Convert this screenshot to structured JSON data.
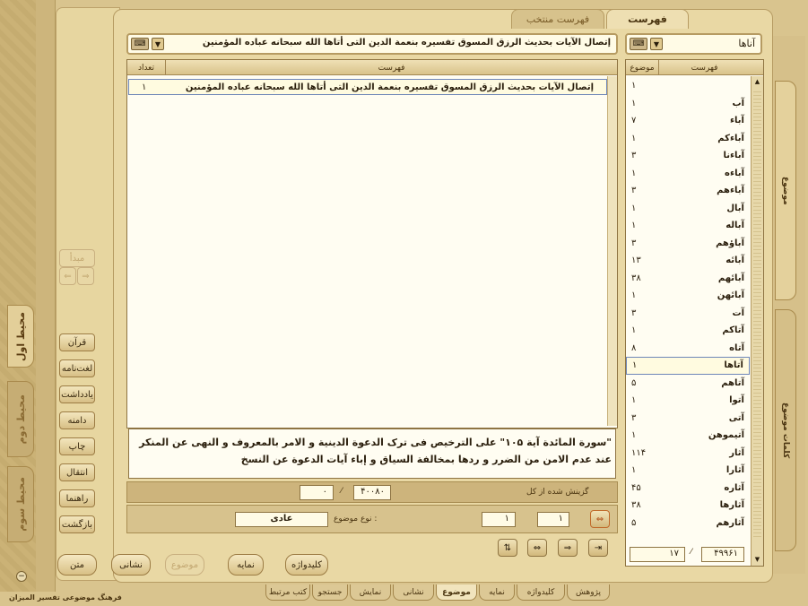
{
  "app_title": "فرهنگ موضوعی تفسیر المیزان",
  "top_tabs": {
    "active": "فهرست",
    "inactive": "فهرست منتخب"
  },
  "left_tabs": [
    "محیط اول",
    "محیط دوم",
    "محیط سوم"
  ],
  "side": {
    "start": "مبدأ",
    "buttons": [
      "قرآن",
      "لغت‌نامه",
      "یادداشت",
      "دامنه",
      "چاپ",
      "انتقال",
      "راهنما",
      "بازگشت"
    ]
  },
  "search_right": {
    "value": "آناها"
  },
  "search_left": {
    "value": "إتصال الآیات بحدیث الرزق المسوق تفسیره بنعمة الدین التی أتاها الله سبحانه عباده المؤمنین"
  },
  "right_list": {
    "col_index": "فهرست",
    "col_count": "موضوع",
    "rows": [
      {
        "w": "",
        "n": "۱"
      },
      {
        "w": "آب",
        "n": "۱"
      },
      {
        "w": "آباء",
        "n": "۷"
      },
      {
        "w": "آباءکم",
        "n": "۱"
      },
      {
        "w": "آباءنا",
        "n": "۳"
      },
      {
        "w": "آباءه",
        "n": "۱"
      },
      {
        "w": "آباءهم",
        "n": "۳"
      },
      {
        "w": "آبال",
        "n": "۱"
      },
      {
        "w": "آباله",
        "n": "۱"
      },
      {
        "w": "آباؤهم",
        "n": "۳"
      },
      {
        "w": "آبائه",
        "n": "۱۳"
      },
      {
        "w": "آبائهم",
        "n": "۳۸"
      },
      {
        "w": "آبائهن",
        "n": "۱"
      },
      {
        "w": "آت",
        "n": "۳"
      },
      {
        "w": "آتاکم",
        "n": "۱"
      },
      {
        "w": "آتاه",
        "n": "۸"
      },
      {
        "w": "آتاها",
        "n": "۱"
      },
      {
        "w": "آتاهم",
        "n": "۵"
      },
      {
        "w": "آتوا",
        "n": "۱"
      },
      {
        "w": "آتی",
        "n": "۳"
      },
      {
        "w": "آتیموهن",
        "n": "۱"
      },
      {
        "w": "آثار",
        "n": "۱۱۴"
      },
      {
        "w": "آثارا",
        "n": "۱"
      },
      {
        "w": "آثاره",
        "n": "۴۵"
      },
      {
        "w": "آثارها",
        "n": "۳۸"
      },
      {
        "w": "آثارهم",
        "n": "۵"
      }
    ],
    "selected_index": 16
  },
  "center_list": {
    "col_index": "فهرست",
    "col_count": "تعداد",
    "row_text": "إتصال الآیات بحدیث الرزق المسوق تفسیره بنعمة الدین التی أتاها الله سبحانه عباده المؤمنین",
    "row_count": "۱"
  },
  "text_box": "\"سورة المائدة آیة ۱۰۵\" علی الترخیص فی ترک الدعوة الدینیة و الامر بالمعروف و النهی عن المنکر عند عدم الامن من الضرر و ردها بمخالفة السیاق و إباء آیات الدعوة عن النسخ",
  "mid_bar": {
    "label": "گزینش شده از کل",
    "total": "۴۰۰۸۰",
    "selected": "۰"
  },
  "page_bar": {
    "type_label": "نوع موضوع :",
    "type_value": "عادی",
    "page_a": "۱",
    "page_b": "۱"
  },
  "right_footer": {
    "total": "۴۹۹۶۱",
    "current": "۱۷"
  },
  "right_side_tabs": [
    "موضوع",
    "کلمات موضوع"
  ],
  "bottom_buttons": [
    "متن",
    "نشانی",
    "موضوع",
    "نمایه",
    "کلیدواژه"
  ],
  "bottom_tabs": [
    "کتب مرتبط",
    "جستجو",
    "نمایش",
    "نشانی",
    "موضوع",
    "نمایه",
    "کلیدواژه",
    "پژوهش"
  ],
  "bottom_tabs_active": "موضوع"
}
